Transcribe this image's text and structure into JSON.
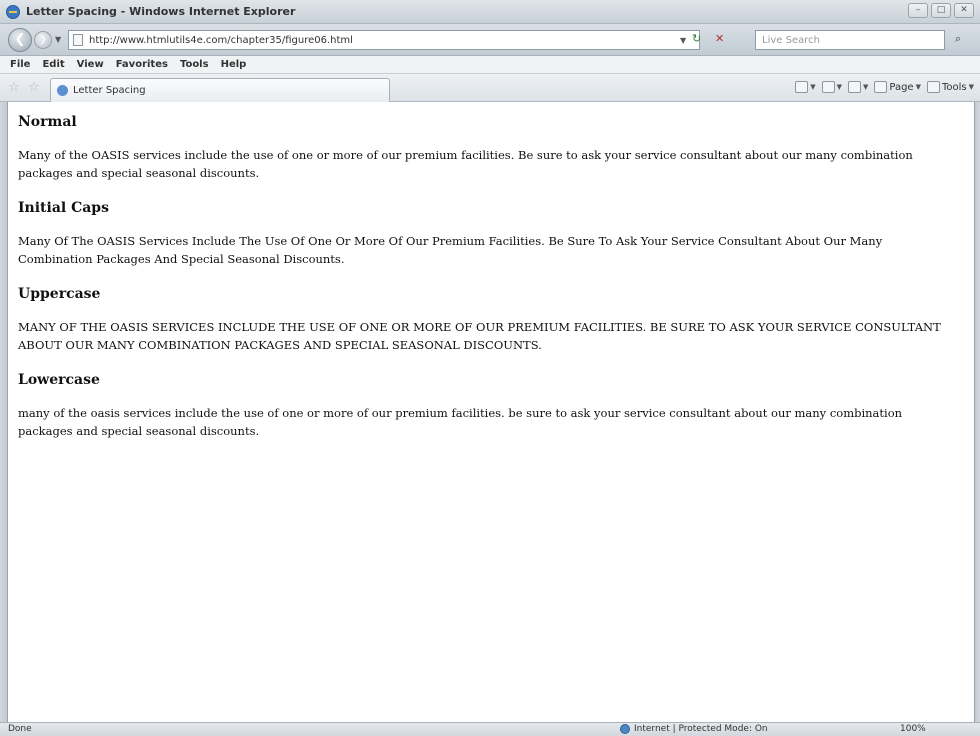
{
  "window": {
    "title": "Letter Spacing - Windows Internet Explorer",
    "controls": [
      "–",
      "□",
      "✕"
    ]
  },
  "address_bar": {
    "url": "http://www.htmlutils4e.com/chapter35/figure06.html",
    "search_placeholder": "Live Search"
  },
  "menu": [
    "File",
    "Edit",
    "View",
    "Favorites",
    "Tools",
    "Help"
  ],
  "tab": {
    "label": "Letter Spacing"
  },
  "command_bar": {
    "page_label": "Page",
    "tools_label": "Tools"
  },
  "content": {
    "sections": [
      {
        "heading": "Normal",
        "text": "Many of the OASIS services include the use of one or more of our premium facilities. Be sure to ask your service consultant about our many combination packages and special seasonal discounts."
      },
      {
        "heading": "Initial Caps",
        "text": "Many of the OASIS services include the use of one or more of our premium facilities. Be sure to ask your service consultant about our many combination packages and special seasonal discounts."
      },
      {
        "heading": "Uppercase",
        "text": "Many of the OASIS services include the use of one or more of our premium facilities. Be sure to ask your service consultant about our many combination packages and special seasonal discounts."
      },
      {
        "heading": "Lowercase",
        "text": "Many of the OASIS services include the use of one or more of our premium facilities. Be sure to ask your service consultant about our many combination packages and special seasonal discounts."
      }
    ]
  },
  "status_bar": {
    "status": "Done",
    "zone": "Internet | Protected Mode: On",
    "zoom": "100%"
  }
}
